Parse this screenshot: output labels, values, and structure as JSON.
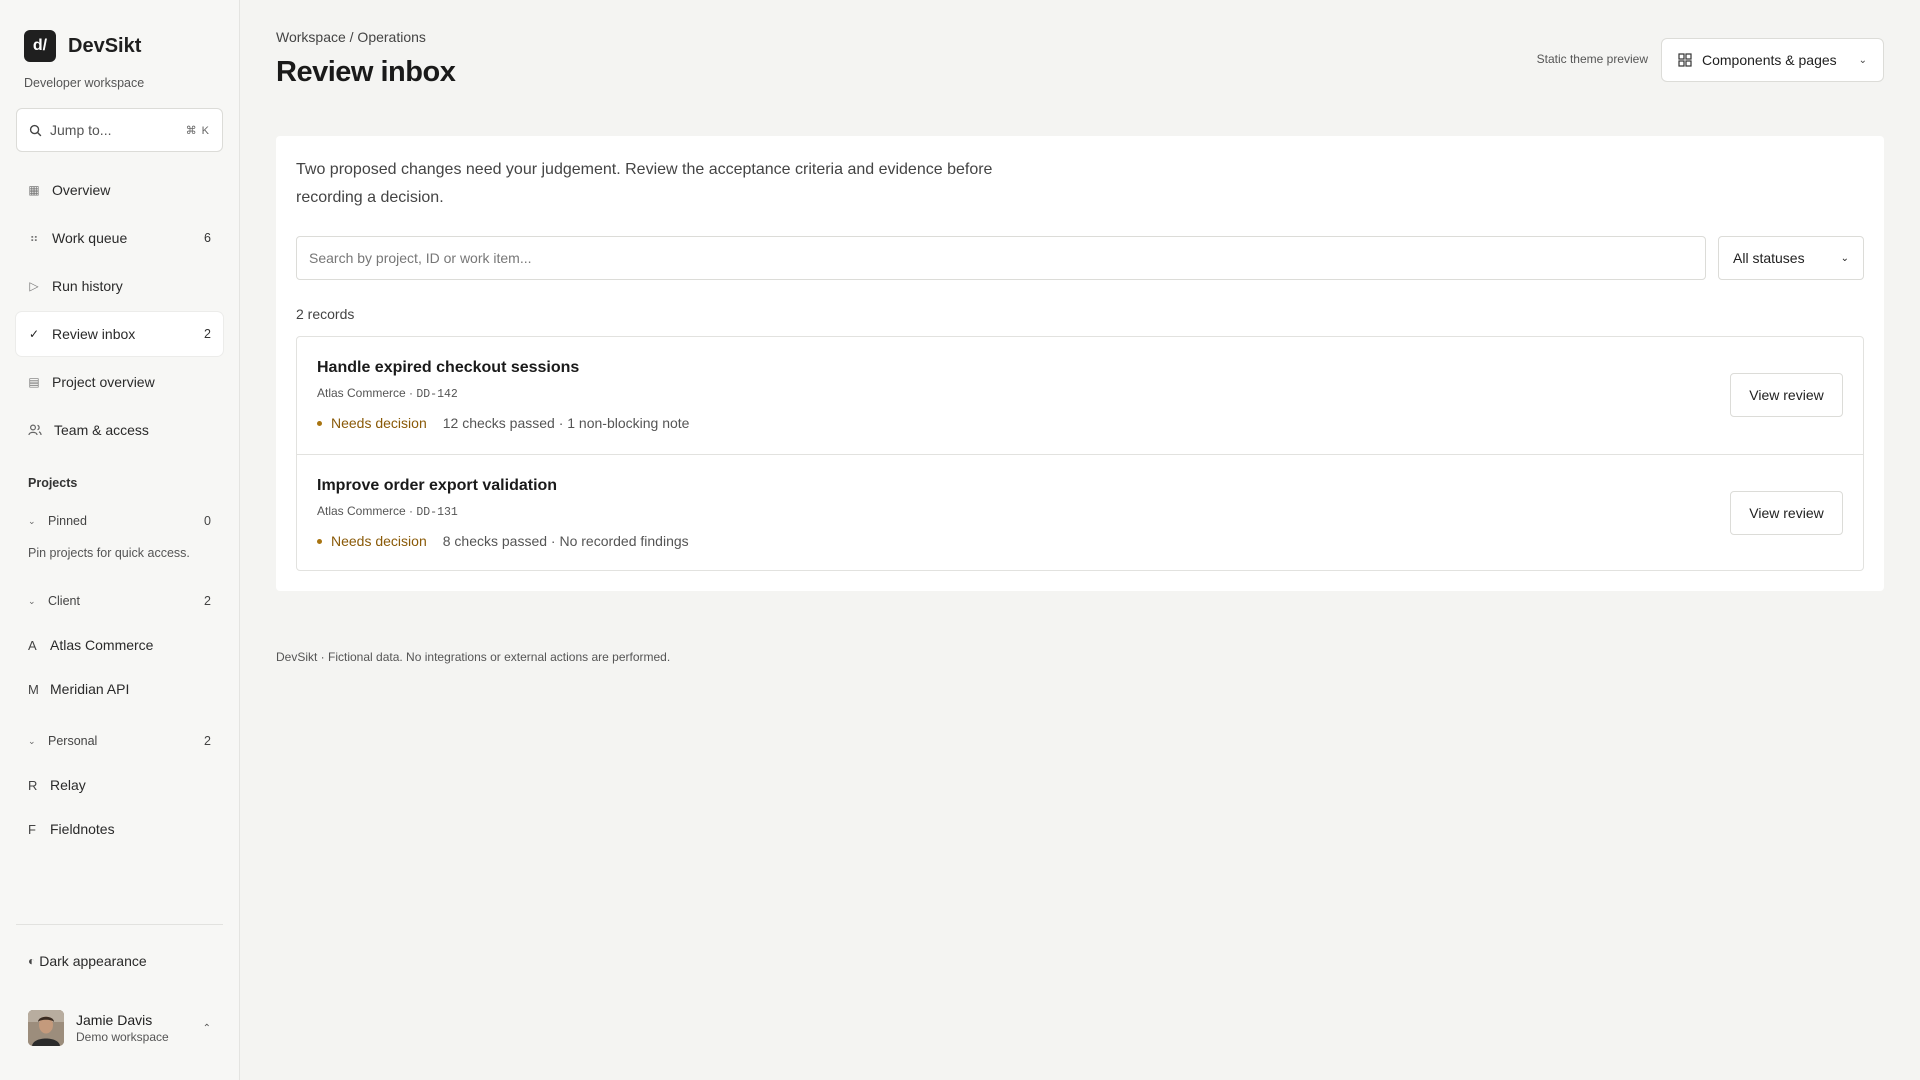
{
  "brand": {
    "logo_text": "d/",
    "name": "DevSikt",
    "subtitle": "Developer workspace"
  },
  "jump": {
    "label": "Jump to...",
    "shortcut": "⌘ K",
    "icon": "search-icon"
  },
  "nav": [
    {
      "label": "Overview",
      "icon": "grid-icon",
      "count": ""
    },
    {
      "label": "Work queue",
      "icon": "list-icon",
      "count": "6"
    },
    {
      "label": "Run history",
      "icon": "play-icon",
      "count": ""
    },
    {
      "label": "Review inbox",
      "icon": "check-icon",
      "count": "2",
      "active": true
    },
    {
      "label": "Project overview",
      "icon": "table-icon",
      "count": ""
    },
    {
      "label": "Team & access",
      "icon": "users-icon",
      "count": ""
    }
  ],
  "projects": {
    "title": "Projects",
    "pinned": {
      "label": "Pinned",
      "count": "0",
      "hint": "Pin projects for quick access."
    },
    "client": {
      "label": "Client",
      "count": "2",
      "items": [
        {
          "letter": "A",
          "name": "Atlas Commerce"
        },
        {
          "letter": "M",
          "name": "Meridian API"
        }
      ]
    },
    "personal": {
      "label": "Personal",
      "count": "2",
      "items": [
        {
          "letter": "R",
          "name": "Relay"
        },
        {
          "letter": "F",
          "name": "Fieldnotes"
        }
      ]
    }
  },
  "appearance": {
    "label": "Dark appearance",
    "icon": "half-circle-icon"
  },
  "user": {
    "name": "Jamie Davis",
    "workspace": "Demo workspace"
  },
  "header": {
    "breadcrumb": "Workspace / Operations",
    "title": "Review inbox",
    "theme_note": "Static theme preview",
    "components_button": "Components & pages"
  },
  "main": {
    "intro": "Two proposed changes need your judgement. Review the acceptance criteria and evidence before recording a decision.",
    "search_placeholder": "Search by project, ID or work item...",
    "status_filter": "All statuses",
    "records": "2 records",
    "items": [
      {
        "title": "Handle expired checkout sessions",
        "project": "Atlas Commerce",
        "id": "DD-142",
        "status": "Needs decision",
        "evidence": "12 checks passed · 1 non-blocking note",
        "action": "View review"
      },
      {
        "title": "Improve order export validation",
        "project": "Atlas Commerce",
        "id": "DD-131",
        "status": "Needs decision",
        "evidence": "8 checks passed · No recorded findings",
        "action": "View review"
      }
    ]
  },
  "footer": "DevSikt · Fictional data. No integrations or external actions are performed.",
  "colors": {
    "accent_status": "#8a5a08",
    "status_dot": "#a87411",
    "background": "#f4f4f2"
  }
}
